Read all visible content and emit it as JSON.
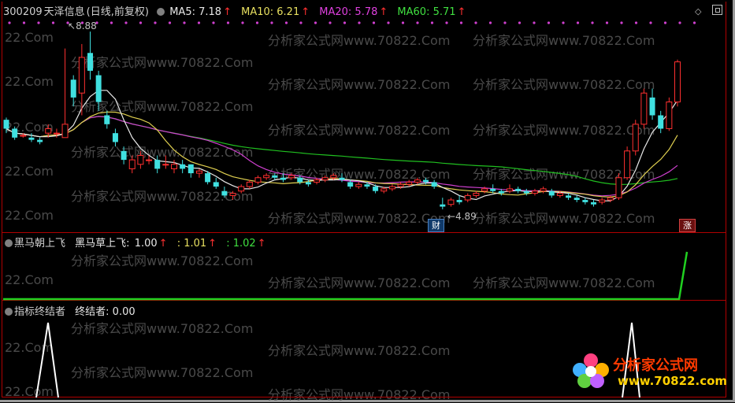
{
  "header": {
    "code": "300209",
    "name": "天泽信息",
    "period": "(日线,前复权)",
    "ma5": {
      "label": "MA5: 7.18",
      "arrow": "↑",
      "color": "#e8e8e8"
    },
    "ma10": {
      "label": "MA10: 6.21",
      "arrow": "↑",
      "color": "#e8e060"
    },
    "ma20": {
      "label": "MA20: 5.78",
      "arrow": "↑",
      "color": "#e040e0"
    },
    "ma60": {
      "label": "MA60: 5.71",
      "arrow": "↑",
      "color": "#40e040"
    }
  },
  "annotations": {
    "high": "8.88",
    "low": "4.89",
    "fin_badge": "财",
    "zhang_badge": "涨"
  },
  "panel1": {
    "name": "黑马朝上飞",
    "line_name": "黑马草上飞:",
    "v1": "1.00",
    "a1": "↑",
    "v2": ": 1.01",
    "a2": "↑",
    "v3": ": 1.02",
    "a3": "↑"
  },
  "panel2": {
    "name": "指标终结者",
    "line": "终结者: 0.00"
  },
  "watermark": {
    "text1": "22.Com",
    "text2": "分析家公式网www.70822.Com"
  },
  "logo": {
    "title": "分析家公式网",
    "url": "www.70822.com"
  },
  "chart_data": {
    "type": "candlestick",
    "candles": [
      [
        6.9,
        6.7,
        6.95,
        6.6
      ],
      [
        6.7,
        6.5,
        6.75,
        6.45
      ],
      [
        6.55,
        6.55,
        6.6,
        6.5
      ],
      [
        6.5,
        6.45,
        6.6,
        6.4
      ],
      [
        6.45,
        6.4,
        6.5,
        6.35
      ],
      [
        6.6,
        6.7,
        6.8,
        6.5
      ],
      [
        6.6,
        6.6,
        6.7,
        6.5
      ],
      [
        6.5,
        6.8,
        8.5,
        6.5
      ],
      [
        7.8,
        7.4,
        7.9,
        7.2
      ],
      [
        7.5,
        8.3,
        8.6,
        7.0
      ],
      [
        8.4,
        8.0,
        8.88,
        7.8
      ],
      [
        7.9,
        7.3,
        8.0,
        7.1
      ],
      [
        7.0,
        6.8,
        7.1,
        6.7
      ],
      [
        6.6,
        6.4,
        6.7,
        6.3
      ],
      [
        6.2,
        6.0,
        6.3,
        5.9
      ],
      [
        5.8,
        6.0,
        6.1,
        5.7
      ],
      [
        5.9,
        6.1,
        6.2,
        5.8
      ],
      [
        6.0,
        6.0,
        6.1,
        5.9
      ],
      [
        6.0,
        5.8,
        6.1,
        5.7
      ],
      [
        5.9,
        5.9,
        6.1,
        5.8
      ],
      [
        5.8,
        5.9,
        6.0,
        5.7
      ],
      [
        5.9,
        5.8,
        6.0,
        5.7
      ],
      [
        5.9,
        5.7,
        5.9,
        5.6
      ],
      [
        5.7,
        5.75,
        5.8,
        5.6
      ],
      [
        5.7,
        5.5,
        5.75,
        5.45
      ],
      [
        5.5,
        5.4,
        5.6,
        5.35
      ],
      [
        5.3,
        5.2,
        5.4,
        5.15
      ],
      [
        5.2,
        5.25,
        5.3,
        5.1
      ],
      [
        5.3,
        5.4,
        5.45,
        5.25
      ],
      [
        5.4,
        5.5,
        5.55,
        5.35
      ],
      [
        5.5,
        5.6,
        5.65,
        5.45
      ],
      [
        5.6,
        5.65,
        5.7,
        5.55
      ],
      [
        5.65,
        5.6,
        5.7,
        5.55
      ],
      [
        5.6,
        5.55,
        5.7,
        5.5
      ],
      [
        5.6,
        5.65,
        5.7,
        5.55
      ],
      [
        5.6,
        5.5,
        5.65,
        5.45
      ],
      [
        5.5,
        5.45,
        5.55,
        5.4
      ],
      [
        5.5,
        5.55,
        5.6,
        5.45
      ],
      [
        5.55,
        5.6,
        5.65,
        5.5
      ],
      [
        5.6,
        5.65,
        5.7,
        5.55
      ],
      [
        5.6,
        5.55,
        5.7,
        5.5
      ],
      [
        5.5,
        5.4,
        5.55,
        5.35
      ],
      [
        5.4,
        5.45,
        5.5,
        5.35
      ],
      [
        5.45,
        5.4,
        5.5,
        5.35
      ],
      [
        5.4,
        5.3,
        5.45,
        5.25
      ],
      [
        5.3,
        5.35,
        5.4,
        5.25
      ],
      [
        5.35,
        5.4,
        5.45,
        5.3
      ],
      [
        5.4,
        5.45,
        5.5,
        5.35
      ],
      [
        5.45,
        5.5,
        5.55,
        5.4
      ],
      [
        5.5,
        5.55,
        5.6,
        5.45
      ],
      [
        5.55,
        5.5,
        5.6,
        5.45
      ],
      [
        5.5,
        5.4,
        5.55,
        5.35
      ],
      [
        5.0,
        4.95,
        5.15,
        4.89
      ],
      [
        5.0,
        5.1,
        5.15,
        4.95
      ],
      [
        5.1,
        5.05,
        5.2,
        5.0
      ],
      [
        5.1,
        5.2,
        5.25,
        5.05
      ],
      [
        5.2,
        5.25,
        5.3,
        5.15
      ],
      [
        5.3,
        5.35,
        5.4,
        5.25
      ],
      [
        5.35,
        5.3,
        5.45,
        5.25
      ],
      [
        5.3,
        5.25,
        5.35,
        5.2
      ],
      [
        5.3,
        5.35,
        5.45,
        5.25
      ],
      [
        5.35,
        5.3,
        5.4,
        5.25
      ],
      [
        5.3,
        5.25,
        5.35,
        5.2
      ],
      [
        5.25,
        5.3,
        5.35,
        5.2
      ],
      [
        5.3,
        5.35,
        5.4,
        5.25
      ],
      [
        5.3,
        5.2,
        5.35,
        5.15
      ],
      [
        5.2,
        5.25,
        5.3,
        5.15
      ],
      [
        5.2,
        5.15,
        5.25,
        5.1
      ],
      [
        5.15,
        5.1,
        5.2,
        5.05
      ],
      [
        5.1,
        5.05,
        5.15,
        5.0
      ],
      [
        5.05,
        5.0,
        5.1,
        4.95
      ],
      [
        5.05,
        5.1,
        5.15,
        5.0
      ],
      [
        5.1,
        5.15,
        5.2,
        5.05
      ],
      [
        5.15,
        5.6,
        5.7,
        5.1
      ],
      [
        5.6,
        6.2,
        6.3,
        5.55
      ],
      [
        6.2,
        6.8,
        6.9,
        6.1
      ],
      [
        6.8,
        7.5,
        7.6,
        6.7
      ],
      [
        7.4,
        7.0,
        7.6,
        6.9
      ],
      [
        7.0,
        6.7,
        7.1,
        6.6
      ],
      [
        6.7,
        7.3,
        7.4,
        6.65
      ],
      [
        7.3,
        8.2,
        8.25,
        7.2
      ]
    ],
    "ylim": [
      4.5,
      9.2
    ]
  }
}
